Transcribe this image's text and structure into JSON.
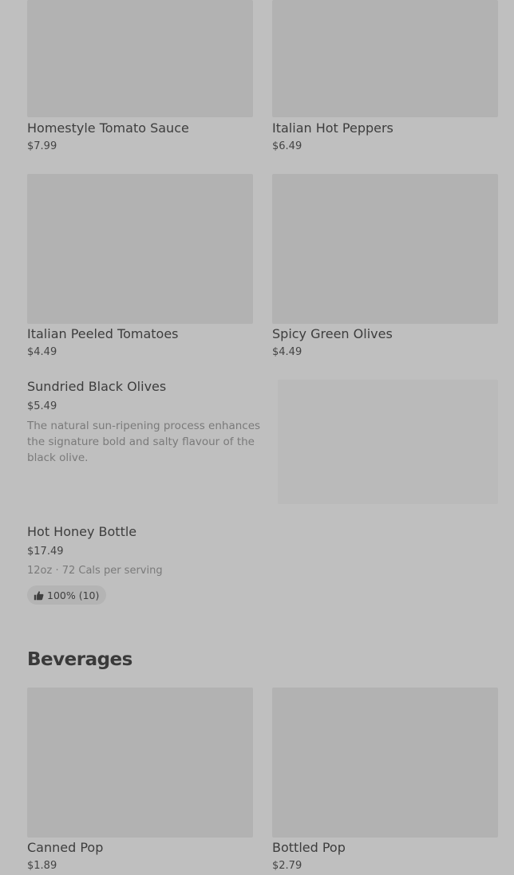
{
  "products": [
    {
      "name": "Homestyle Tomato Sauce",
      "price": "$7.99"
    },
    {
      "name": "Italian Hot Peppers",
      "price": "$6.49"
    },
    {
      "name": "Italian Peeled Tomatoes",
      "price": "$4.49"
    },
    {
      "name": "Spicy Green Olives",
      "price": "$4.49"
    }
  ],
  "list_items": [
    {
      "name": "Sundried Black Olives",
      "price": "$5.49",
      "description": "The natural sun-ripening process enhances the signature bold and salty flavour of the black olive."
    },
    {
      "name": "Hot Honey Bottle",
      "price": "$17.49",
      "meta": "12oz · 72 Cals per serving",
      "rating": "100% (10)",
      "rating_icon": "thumbs-up-icon"
    }
  ],
  "beverages": {
    "title": "Beverages",
    "items": [
      {
        "name": "Canned Pop",
        "price": "$1.89"
      },
      {
        "name": "Bottled Pop",
        "price": "$2.79"
      }
    ]
  },
  "colors": {
    "overlay": "#bfbfbf",
    "image_placeholder": "#b2b2b2"
  }
}
